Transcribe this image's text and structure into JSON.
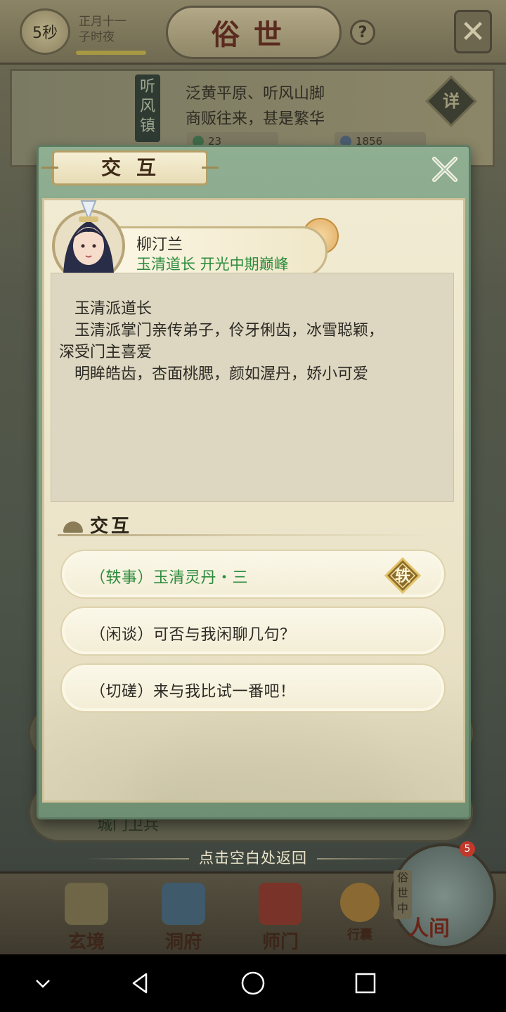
{
  "topbar": {
    "timer": "5秒",
    "date_line1": "正月十一",
    "date_line2": "子时夜",
    "title": "俗世",
    "help": "?"
  },
  "location": {
    "name": "听风镇",
    "desc_line1": "泛黄平原、听风山脚",
    "desc_line2": "商贩往来，甚是繁华",
    "detail": "详",
    "jade": "23",
    "stone": "1856"
  },
  "background": {
    "guard_label": "城门卫兵"
  },
  "dialog": {
    "title": "交互",
    "npc": {
      "name": "柳汀兰",
      "title": "玉清道长 开光中期巅峰"
    },
    "description": [
      "　玉清派道长",
      "　玉清派掌门亲传弟子，伶牙俐齿，冰雪聪颖，",
      "深受门主喜爱",
      "　明眸皓齿，杏面桃腮，颜如渥丹，娇小可爱"
    ],
    "section_title": "交互",
    "options": [
      {
        "label": "（轶事）玉清灵丹・三",
        "tag": "轶",
        "style": "green"
      },
      {
        "label": "（闲谈）可否与我闲聊几句？",
        "style": "normal"
      },
      {
        "label": "（切磋）来与我比试一番吧！",
        "style": "normal"
      }
    ]
  },
  "return_hint": "点击空白处返回",
  "bottom_nav": {
    "items": [
      "玄境",
      "洞府",
      "师门",
      "行囊"
    ],
    "world": "人间",
    "world_tag": "俗世中",
    "badge": "5"
  },
  "colors": {
    "green_text": "#2c8b3d",
    "dialog_frame": "#8fae92",
    "paper": "#f1ebd3"
  }
}
